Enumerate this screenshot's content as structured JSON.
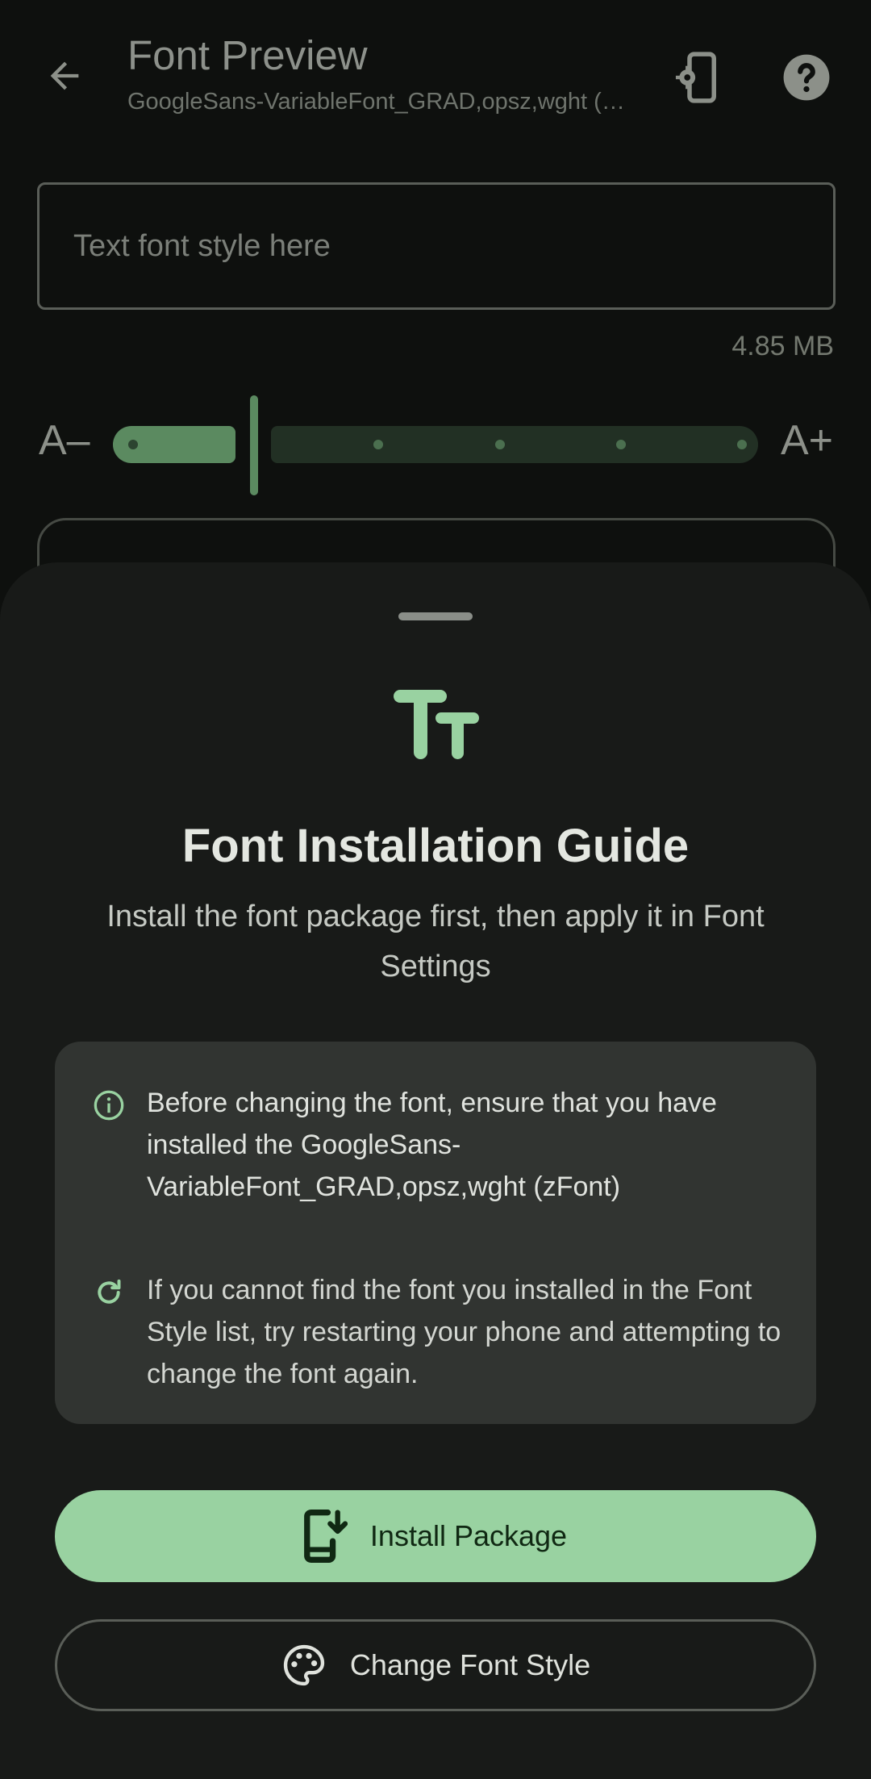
{
  "header": {
    "title": "Font Preview",
    "subtitle": "GoogleSans-VariableFont_GRAD,opsz,wght (zFont)",
    "icons": {
      "back": "arrow-back-icon",
      "device_settings": "device-settings-icon",
      "help": "help-icon"
    }
  },
  "preview": {
    "placeholder": "Text font style here",
    "value": "",
    "file_size": "4.85 MB"
  },
  "size_slider": {
    "decrease_label": "A–",
    "increase_label": "A+",
    "steps": 6,
    "selected_step_fraction": 0.2
  },
  "sheet": {
    "title": "Font Installation Guide",
    "subtitle": "Install the font package first, then apply it in Font Settings",
    "info_items": [
      {
        "icon": "info-icon",
        "text": "Before changing the font, ensure that you have installed the GoogleSans-VariableFont_GRAD,opsz,wght (zFont)"
      },
      {
        "icon": "refresh-icon",
        "text": "If you cannot find the font you installed in the Font Style list, try restarting your phone and attempting to change the font again."
      }
    ],
    "install_button": {
      "label": "Install Package",
      "icon": "install-mobile-icon"
    },
    "change_button": {
      "label": "Change Font Style",
      "icon": "palette-icon"
    }
  },
  "colors": {
    "accent": "#99d2a1",
    "background": "#0e100e",
    "sheet": "#181a18",
    "card": "#313431"
  }
}
